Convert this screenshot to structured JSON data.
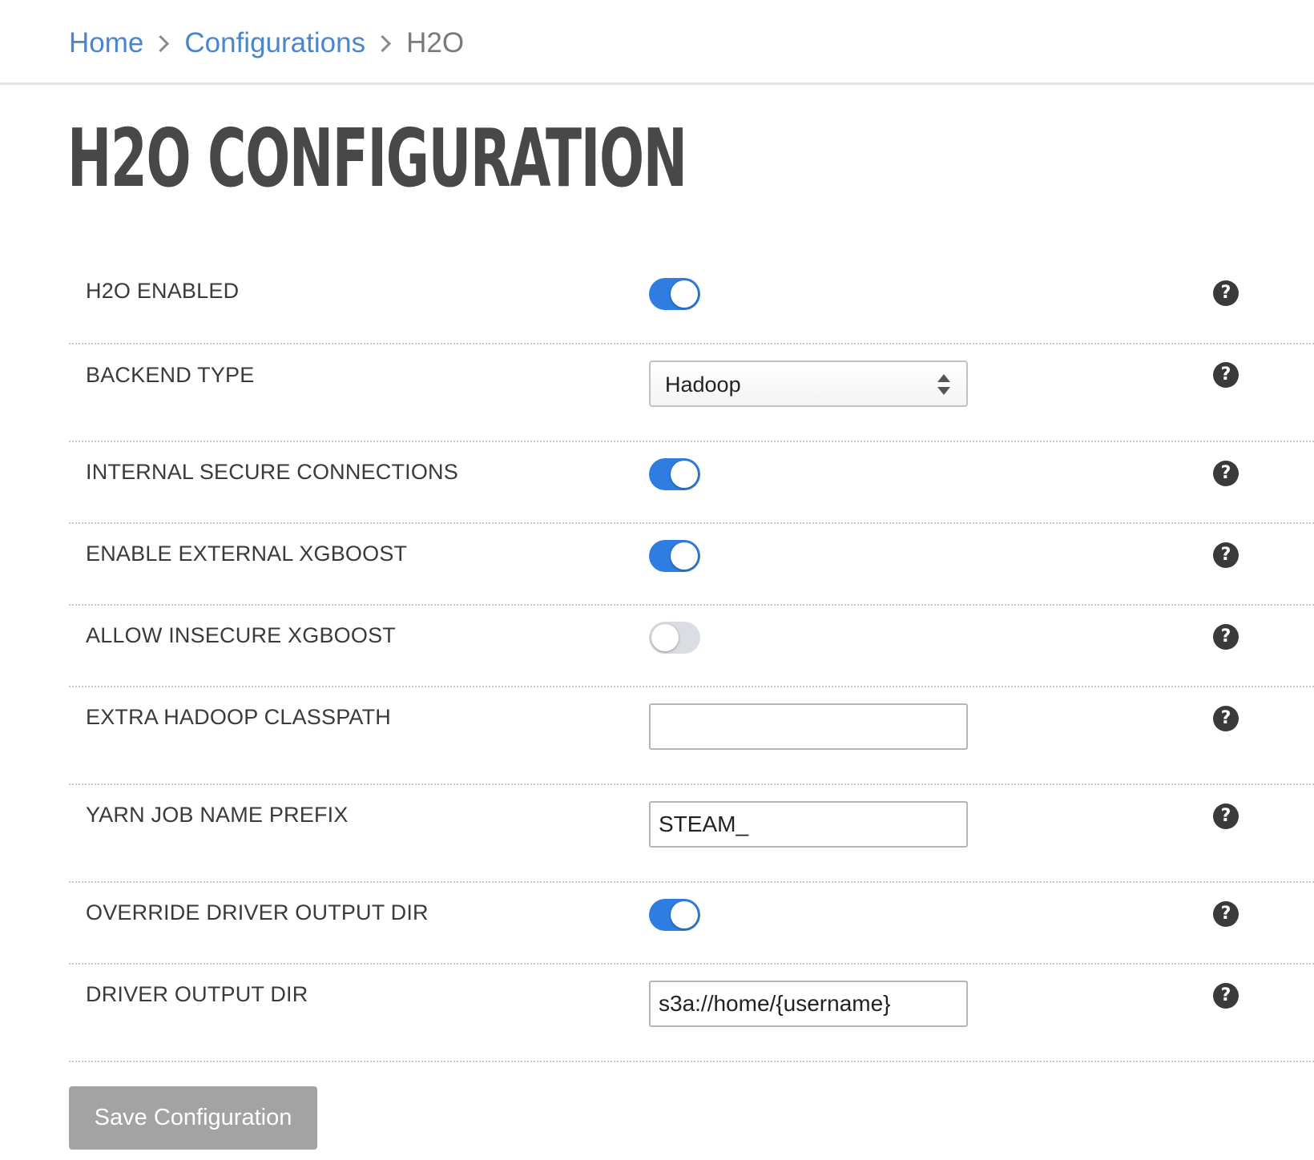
{
  "breadcrumb": {
    "home": "Home",
    "configurations": "Configurations",
    "current": "H2O"
  },
  "page": {
    "title": "H2O CONFIGURATION"
  },
  "settings": {
    "h2o_enabled": {
      "label": "H2O ENABLED",
      "value": true
    },
    "backend_type": {
      "label": "BACKEND TYPE",
      "value": "Hadoop"
    },
    "internal_secure_connections": {
      "label": "INTERNAL SECURE CONNECTIONS",
      "value": true
    },
    "enable_external_xgboost": {
      "label": "ENABLE EXTERNAL XGBOOST",
      "value": true
    },
    "allow_insecure_xgboost": {
      "label": "ALLOW INSECURE XGBOOST",
      "value": false
    },
    "extra_hadoop_classpath": {
      "label": "EXTRA HADOOP CLASSPATH",
      "value": "",
      "placeholder": ""
    },
    "yarn_job_name_prefix": {
      "label": "YARN JOB NAME PREFIX",
      "value": "STEAM_"
    },
    "override_driver_output_dir": {
      "label": "OVERRIDE DRIVER OUTPUT DIR",
      "value": true
    },
    "driver_output_dir": {
      "label": "DRIVER OUTPUT DIR",
      "value": "s3a://home/{username}"
    }
  },
  "help": {
    "glyph": "?"
  },
  "icons": {
    "help": "question-circle-icon",
    "breadcrumb_separator": "chevron-right-icon",
    "select_arrows": "sort-arrows-icon"
  },
  "colors": {
    "link": "#4a86d0",
    "toggle_on": "#2f7de1",
    "toggle_off": "#dadde2",
    "button_disabled": "#a3a3a3"
  },
  "actions": {
    "save_label": "Save Configuration"
  }
}
